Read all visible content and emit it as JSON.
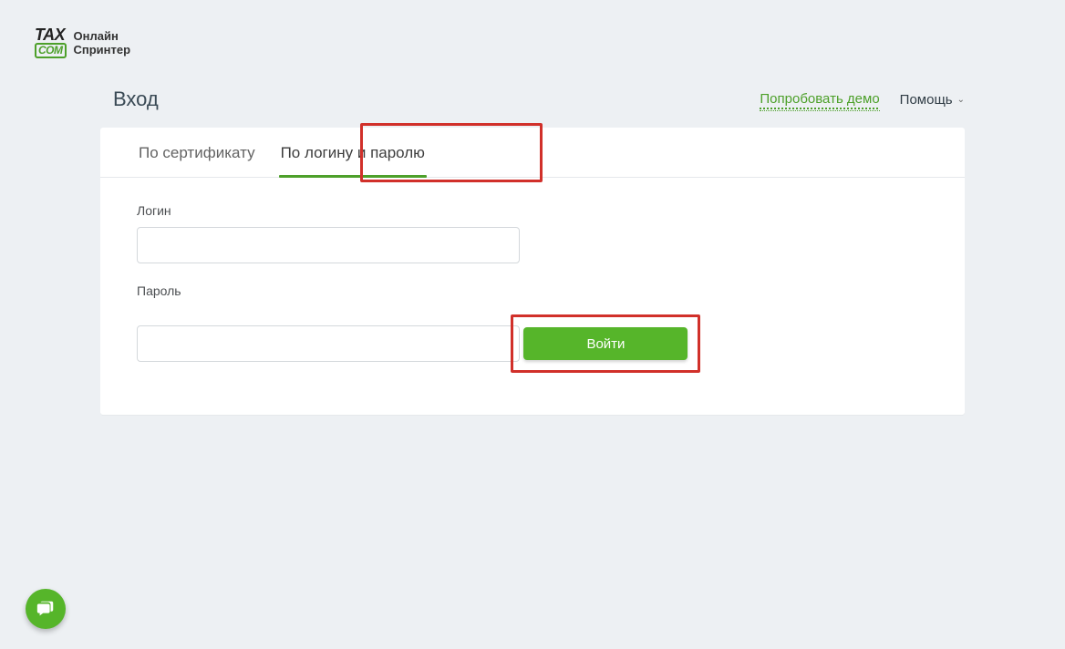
{
  "logo": {
    "tax": "TAX",
    "com": "COM",
    "line1": "Онлайн",
    "line2": "Спринтер"
  },
  "header": {
    "title": "Вход",
    "demo": "Попробовать демо",
    "help": "Помощь"
  },
  "tabs": {
    "cert": "По сертификату",
    "login": "По логину и паролю"
  },
  "form": {
    "login_label": "Логин",
    "login_value": "",
    "password_label": "Пароль",
    "password_value": "",
    "submit": "Войти"
  }
}
